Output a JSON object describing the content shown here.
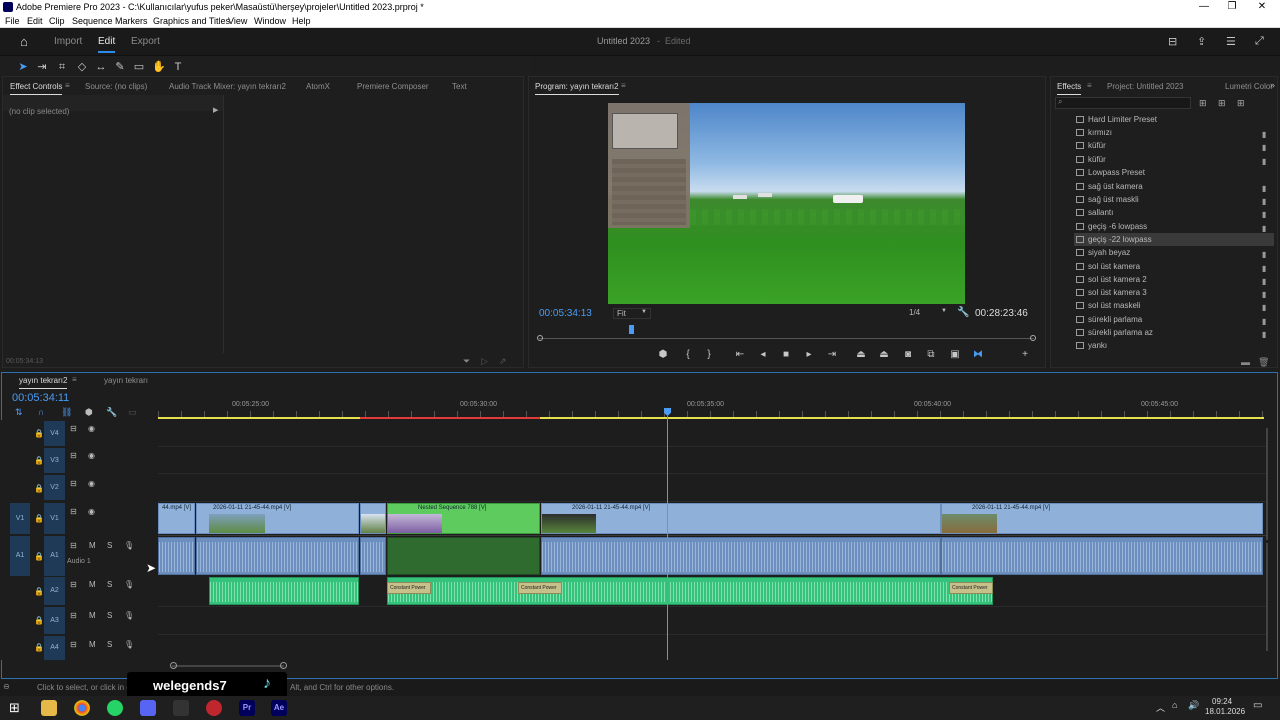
{
  "window": {
    "title": "Adobe Premiere Pro 2023 - C:\\Kullanıcılar\\yufus peker\\Masaüstü\\herşey\\projeler\\Untitled 2023.prproj *",
    "controls": [
      "—",
      "❐",
      "✕"
    ]
  },
  "menu": [
    "File",
    "Edit",
    "Clip",
    "Sequence",
    "Markers",
    "Graphics and Titles",
    "View",
    "Window",
    "Help"
  ],
  "header": {
    "tabs": [
      "Import",
      "Edit",
      "Export"
    ],
    "active_tab": "Edit",
    "project_name": "Untitled 2023",
    "project_status": "Edited"
  },
  "source_panel": {
    "tabs": [
      "Effect Controls",
      "Source: (no clips)",
      "Audio Track Mixer: yayın tekrarı2",
      "AtomX",
      "Premiere Composer",
      "Text"
    ],
    "empty_text": "(no clip selected)",
    "timecode": "00:05:34:13"
  },
  "program_panel": {
    "title": "Program: yayın tekrarı2",
    "timecode": "00:05:34:13",
    "fit": "Fit",
    "resolution": "1/4",
    "duration": "00:28:23:46"
  },
  "effects_panel": {
    "tabs": [
      "Effects",
      "Project: Untitled 2023",
      "Lumetri Color"
    ],
    "items": [
      "Hard Limiter Preset",
      "kırmızı",
      "küfür",
      "küfür",
      "Lowpass Preset",
      "sağ üst kamera",
      "sağ üst maskli",
      "sallantı",
      "geçiş -6 lowpass",
      "geçiş -22 lowpass",
      "siyah beyaz",
      "sol üst kamera",
      "sol üst kamera 2",
      "sol üst kamera 3",
      "sol üst maskeli",
      "sürekli parlama",
      "sürekli parlama az",
      "yankı"
    ],
    "selected_index": 9
  },
  "timeline": {
    "tabs": [
      "yayın tekrarı2",
      "yayın tekrarı"
    ],
    "timecode": "00:05:34:11",
    "ruler": [
      "00:05:25:00",
      "00:05:30:00",
      "00:05:35:00",
      "00:05:40:00",
      "00:05:45:00"
    ],
    "tracks": {
      "video": [
        "V4",
        "V3",
        "V2",
        "V1"
      ],
      "audio": [
        "A1",
        "A2",
        "A3",
        "A4"
      ],
      "audio1_label": "Audio 1",
      "source_v": "V1",
      "source_a": "A1"
    },
    "clips": {
      "v1": [
        "44.mp4 [V]",
        "2026-01-11 21-45-44.mp4 [V]",
        "Nested Sequence 788 [V]",
        "2026-01-11 21-45-44.mp4 [V]",
        "2026-01-11 21-45-44.mp4 [V]"
      ],
      "transition": "Constant Power"
    }
  },
  "status_bar": {
    "text_left": "Click to select, or click in e",
    "text_right": "Alt, and Ctrl for other options."
  },
  "overlay": {
    "username": "welegends7"
  },
  "taskbar": {
    "time": "09:24",
    "date": "18.01.2026"
  },
  "colors": {
    "accent": "#2d8ceb",
    "video_clip": "#8fb0d8",
    "nested_clip": "#5ecb5e",
    "audio_clip": "#35c27a"
  }
}
